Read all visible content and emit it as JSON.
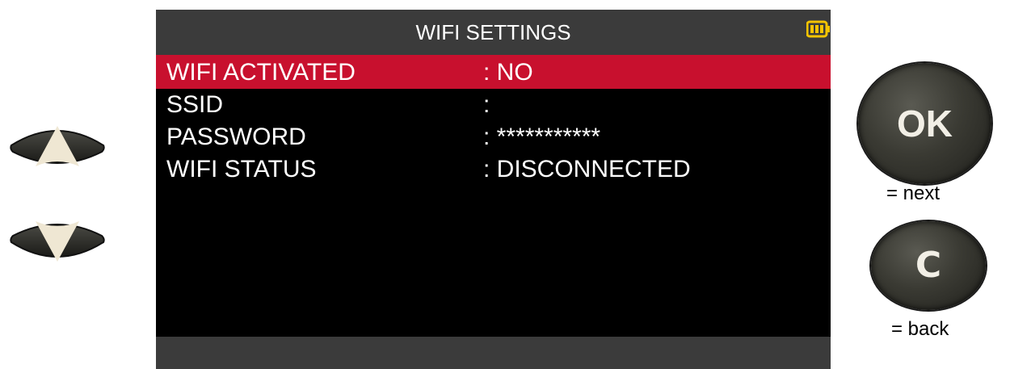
{
  "screen": {
    "title": "WIFI SETTINGS",
    "battery_icon": "battery-full-icon",
    "rows": [
      {
        "label": "WIFI ACTIVATED",
        "value": ": NO",
        "selected": true
      },
      {
        "label": "SSID",
        "value": ":",
        "selected": false
      },
      {
        "label": "PASSWORD",
        "value": ": ***********",
        "selected": false
      },
      {
        "label": "WIFI STATUS",
        "value": ": DISCONNECTED",
        "selected": false
      }
    ]
  },
  "keys": {
    "up_icon": "arrow-up-icon",
    "down_icon": "arrow-down-icon",
    "ok_label": "OK",
    "ok_caption": "= next",
    "c_label": "C",
    "c_caption": "= back"
  },
  "colors": {
    "selection": "#c8102e",
    "titlebar": "#3b3b3b",
    "screen_bg": "#000000",
    "battery": "#f5c400"
  }
}
